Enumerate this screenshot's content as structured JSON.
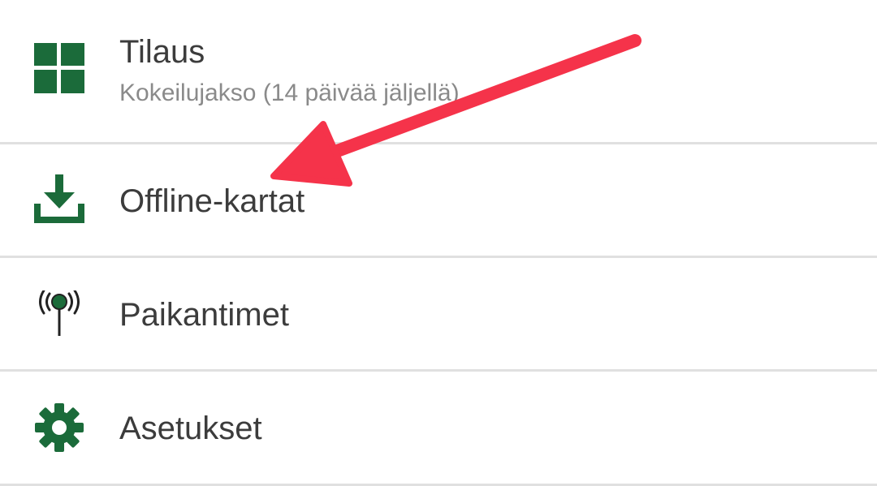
{
  "menu": {
    "items": [
      {
        "label": "Tilaus",
        "sublabel": "Kokeilujakso (14 päivää jäljellä)",
        "icon": "grid-icon"
      },
      {
        "label": "Offline-kartat",
        "icon": "download-icon"
      },
      {
        "label": "Paikantimet",
        "icon": "tracker-antenna-icon"
      },
      {
        "label": "Asetukset",
        "icon": "gear-icon"
      }
    ]
  },
  "colors": {
    "icon_green": "#1b6b3a",
    "label_text": "#3c3c3c",
    "sublabel_text": "#8a8a8a",
    "divider": "#e0e0e0",
    "annotation_arrow": "#f5334a"
  }
}
